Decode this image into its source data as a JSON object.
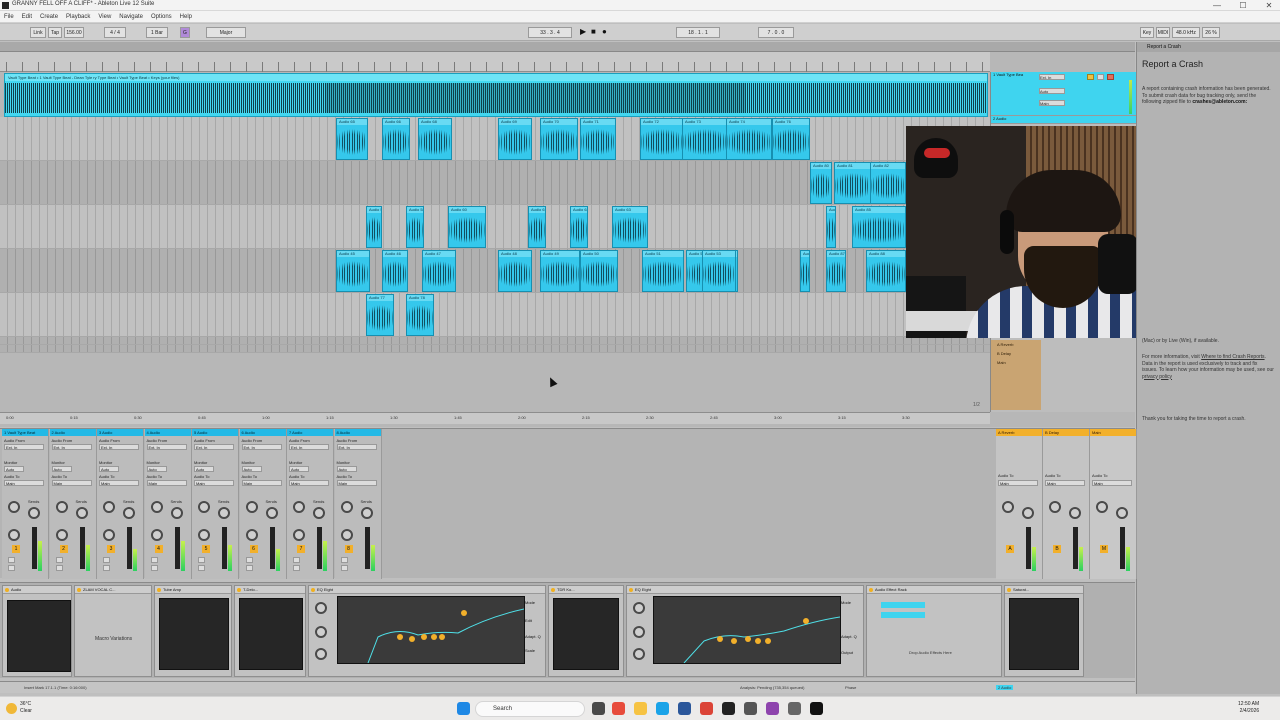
{
  "window": {
    "title": "GRANNY FELL OFF A CLIFF* - Ableton Live 12 Suite",
    "controls": [
      "—",
      "☐",
      "✕"
    ]
  },
  "menu": [
    "File",
    "Edit",
    "Create",
    "Playback",
    "View",
    "Navigate",
    "Options",
    "Help"
  ],
  "transport": {
    "link": "Link",
    "tap": "Tap",
    "tempo": "156.00",
    "time_sig": "4 / 4",
    "quantize": "1 Bar",
    "key": "G",
    "scale": "Major",
    "position": "33 . 3 . 4",
    "loop_start": "18 . 1 . 1",
    "loop_length": "7 . 0 . 0",
    "key_label": "Key",
    "midi_label": "MIDI",
    "sample_rate": "48.0 kHz",
    "cpu": "26 %"
  },
  "arrangement": {
    "main_clip_label": "Vault Type Beat • 1 Vault Type Beat - Dean Tyle  ry Type Beat • Vault Type Beat • Keys  (your files)",
    "clips": [
      {
        "lane": 0,
        "label": "Audio 65"
      },
      {
        "lane": 0,
        "label": "Audio 66"
      },
      {
        "lane": 0,
        "label": "Audio 68"
      },
      {
        "lane": 0,
        "label": "Audio 69"
      },
      {
        "lane": 0,
        "label": "Audio 70"
      },
      {
        "lane": 0,
        "label": "Audio 71"
      },
      {
        "lane": 0,
        "label": "Audio 72"
      },
      {
        "lane": 0,
        "label": "Audio 73"
      },
      {
        "lane": 0,
        "label": "Audio 74"
      },
      {
        "lane": 0,
        "label": "Audio 76"
      },
      {
        "lane": 1,
        "label": "Audio 80"
      },
      {
        "lane": 1,
        "label": "Audio 81"
      },
      {
        "lane": 1,
        "label": "Audio 82"
      },
      {
        "lane": 2,
        "label": "Audio 57"
      },
      {
        "lane": 2,
        "label": "Audio 58"
      },
      {
        "lane": 2,
        "label": "Audio 60"
      },
      {
        "lane": 2,
        "label": "Audio 61"
      },
      {
        "lane": 2,
        "label": "Audio 62"
      },
      {
        "lane": 2,
        "label": "Audio 63"
      },
      {
        "lane": 2,
        "label": "Audio 84"
      },
      {
        "lane": 2,
        "label": "Audio 85"
      },
      {
        "lane": 3,
        "label": "Audio 45"
      },
      {
        "lane": 3,
        "label": "Audio 46"
      },
      {
        "lane": 3,
        "label": "Audio 47"
      },
      {
        "lane": 3,
        "label": "Audio 48"
      },
      {
        "lane": 3,
        "label": "Audio 49"
      },
      {
        "lane": 3,
        "label": "Audio 50"
      },
      {
        "lane": 3,
        "label": "Audio 51"
      },
      {
        "lane": 3,
        "label": "Audio 52"
      },
      {
        "lane": 3,
        "label": "Audio 53"
      },
      {
        "lane": 3,
        "label": "Audio 86"
      },
      {
        "lane": 3,
        "label": "Audio 87"
      },
      {
        "lane": 3,
        "label": "Audio 88"
      },
      {
        "lane": 4,
        "label": "Audio 77"
      },
      {
        "lane": 4,
        "label": "Audio 78"
      }
    ],
    "timeline": [
      "0:00",
      "0:15",
      "0:30",
      "0:45",
      "1:00",
      "1:15",
      "1:30",
      "1:45",
      "2:00",
      "2:15",
      "2:30",
      "2:45",
      "3:00",
      "3:15",
      "3:30"
    ],
    "page": "1/2",
    "track_headers": [
      {
        "name": "1 Vault Type Bea"
      },
      {
        "name": "2 Audio"
      }
    ],
    "returns": [
      "A Reverb",
      "B Delay",
      "Main"
    ],
    "io": [
      "Ext. In",
      "1/2",
      "Auto",
      "Off",
      "Main"
    ]
  },
  "crash_panel": {
    "tab": "Report a Crash",
    "heading": "Report a Crash",
    "p1": "A report containing crash information has been generated. To submit crash data for bug tracking only, send the following zipped file to",
    "email": "crashes@ableton.com:",
    "p2": "(Mac) or by Live (Win), if available.",
    "p3a": "For more information, visit",
    "p3link": "Where to find Crash Reports",
    "p3b": ". Data in the report is used exclusively to track and fix issues. To learn how your information may be used, see our",
    "p3link2": "privacy policy",
    "p4": "Thank you for taking the time to report a crash."
  },
  "mixer": {
    "tracks": [
      {
        "name": "1 Vault Type Beat",
        "num": "1"
      },
      {
        "name": "2 Audio",
        "num": "2"
      },
      {
        "name": "3 Audio",
        "num": "3"
      },
      {
        "name": "4 Audio",
        "num": "4"
      },
      {
        "name": "5 Audio",
        "num": "5"
      },
      {
        "name": "6 Audio",
        "num": "6"
      },
      {
        "name": "7 Audio",
        "num": "7"
      },
      {
        "name": "8 Audio",
        "num": "8"
      }
    ],
    "labels": {
      "audio_from": "Audio From",
      "monitor": "Monitor",
      "audio_to": "Audio To",
      "sends": "Sends",
      "ext_in": "Ext. In",
      "main": "Main",
      "in": "In",
      "auto": "Auto",
      "off": "Off"
    },
    "returns": [
      {
        "name": "A Reverb",
        "num": "A"
      },
      {
        "name": "B Delay",
        "num": "B"
      },
      {
        "name": "Main",
        "num": "M"
      }
    ],
    "cue_out": "Cue Out",
    "main_out": "Main Out",
    "post": "Post"
  },
  "devices": [
    {
      "name": "Audio",
      "label": ""
    },
    {
      "name": "ZLAM VOCAL C...",
      "label": "Macro Variations"
    },
    {
      "name": "Tube Amp",
      "label": ""
    },
    {
      "name": "T-Delo...",
      "label": ""
    },
    {
      "name": "EQ Eight",
      "label": ""
    },
    {
      "name": "TDR Ko...",
      "label": ""
    },
    {
      "name": "EQ Eight",
      "label": ""
    },
    {
      "name": "Audio Effect Rack",
      "label": "Drop Audio Effects Here"
    },
    {
      "name": "Saturat...",
      "label": ""
    }
  ],
  "eq_controls": {
    "freq": "Freq",
    "gain": "Gain",
    "q": "Q",
    "mode": "Mode",
    "edit": "Edit",
    "adapt_q": "Adapt. Q",
    "scale": "Scale",
    "output": "Output",
    "stereo": "Stereo"
  },
  "status": {
    "left": "Insert Mark 17.1.1 (Time: 0:16:000)",
    "middle": "Analysis: Pending (735,354 queued)",
    "right": "Phase",
    "track_sel": "2 Audio"
  },
  "taskbar": {
    "weather_temp": "36°C",
    "weather_desc": "Clear",
    "search": "Search",
    "time": "12:50 AM",
    "date": "2/4/2026"
  },
  "colors": {
    "clip": "#35c8ec",
    "track_header": "#23b9e6",
    "return_header": "#f2b02b",
    "meter_green": "#36d16a"
  }
}
